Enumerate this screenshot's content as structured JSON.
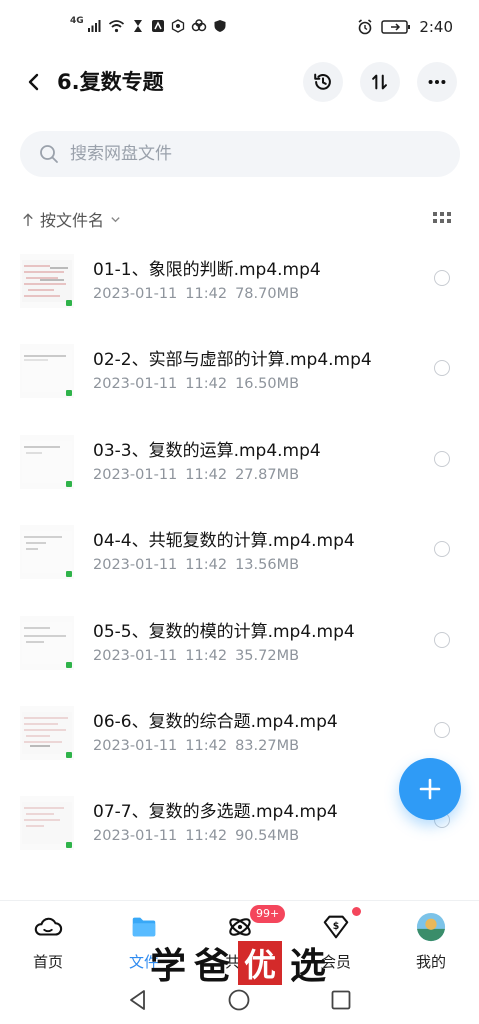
{
  "status_bar": {
    "network": "4G",
    "time": "2:40"
  },
  "title_bar": {
    "title": "6.复数专题"
  },
  "search": {
    "placeholder": "搜索网盘文件"
  },
  "sort": {
    "label": "按文件名"
  },
  "files": [
    {
      "name": "01-1、象限的判断.mp4.mp4",
      "date": "2023-01-11",
      "time": "11:42",
      "size": "78.70MB"
    },
    {
      "name": "02-2、实部与虚部的计算.mp4.mp4",
      "date": "2023-01-11",
      "time": "11:42",
      "size": "16.50MB"
    },
    {
      "name": "03-3、复数的运算.mp4.mp4",
      "date": "2023-01-11",
      "time": "11:42",
      "size": "27.87MB"
    },
    {
      "name": "04-4、共轭复数的计算.mp4.mp4",
      "date": "2023-01-11",
      "time": "11:42",
      "size": "13.56MB"
    },
    {
      "name": "05-5、复数的模的计算.mp4.mp4",
      "date": "2023-01-11",
      "time": "11:42",
      "size": "35.72MB"
    },
    {
      "name": "06-6、复数的综合题.mp4.mp4",
      "date": "2023-01-11",
      "time": "11:42",
      "size": "83.27MB"
    },
    {
      "name": "07-7、复数的多选题.mp4.mp4",
      "date": "2023-01-11",
      "time": "11:42",
      "size": "90.54MB"
    }
  ],
  "bottom_nav": {
    "home": "首页",
    "files": "文件",
    "share": "共享",
    "vip": "会员",
    "mine": "我的",
    "share_badge": "99+"
  },
  "watermark": {
    "char1": "学",
    "char2": "爸",
    "seal": "优",
    "char3": "选"
  },
  "colors": {
    "accent": "#2f9bf6",
    "badge": "#f4465c",
    "seal": "#d42a2a"
  }
}
